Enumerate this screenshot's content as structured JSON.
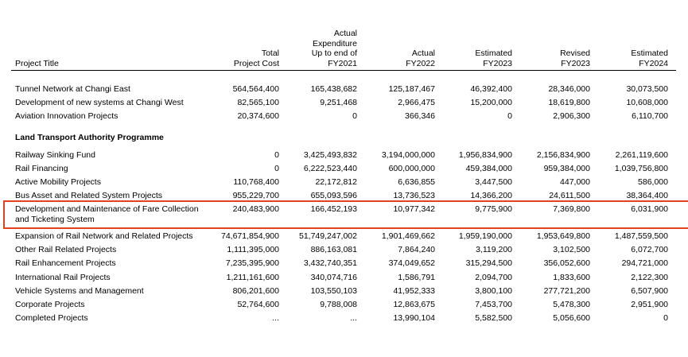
{
  "headers": {
    "project_title": "Project Title",
    "total_cost": "Total\nProject Cost",
    "actual_exp": "Actual\nExpenditure\nUp to end of\nFY2021",
    "actual_fy2022": "Actual\nFY2022",
    "estimated_fy2023": "Estimated\nFY2023",
    "revised_fy2023": "Revised\nFY2023",
    "estimated_fy2024": "Estimated\nFY2024"
  },
  "rows_top": [
    {
      "title": "Tunnel Network at Changi East",
      "v": [
        "564,564,400",
        "165,438,682",
        "125,187,467",
        "46,392,400",
        "28,346,000",
        "30,073,500"
      ]
    },
    {
      "title": "Development of new systems at Changi West",
      "v": [
        "82,565,100",
        "9,251,468",
        "2,966,475",
        "15,200,000",
        "18,619,800",
        "10,608,000"
      ]
    },
    {
      "title": "Aviation Innovation Projects",
      "v": [
        "20,374,600",
        "0",
        "366,346",
        "0",
        "2,906,300",
        "6,110,700"
      ]
    }
  ],
  "section_title": "Land Transport Authority Programme",
  "rows_lta": [
    {
      "title": "Railway Sinking Fund",
      "v": [
        "0",
        "3,425,493,832",
        "3,194,000,000",
        "1,956,834,900",
        "2,156,834,900",
        "2,261,119,600"
      ]
    },
    {
      "title": "Rail Financing",
      "v": [
        "0",
        "6,222,523,440",
        "600,000,000",
        "459,384,000",
        "959,384,000",
        "1,039,756,800"
      ]
    },
    {
      "title": "Active Mobility Projects",
      "v": [
        "110,768,400",
        "22,172,812",
        "6,636,855",
        "3,447,500",
        "447,000",
        "586,000"
      ]
    },
    {
      "title": "Bus Asset and Related System Projects",
      "v": [
        "955,229,700",
        "655,093,596",
        "13,736,523",
        "14,366,200",
        "24,611,500",
        "38,364,400"
      ]
    }
  ],
  "highlight_row": {
    "title": "Development and Maintenance of Fare Collection\nand Ticketing System",
    "v": [
      "240,483,900",
      "166,452,193",
      "10,977,342",
      "9,775,900",
      "7,369,800",
      "6,031,900"
    ]
  },
  "rows_bottom": [
    {
      "title": "Expansion of Rail Network and Related Projects",
      "v": [
        "74,671,854,900",
        "51,749,247,002",
        "1,901,469,662",
        "1,959,190,000",
        "1,953,649,800",
        "1,487,559,500"
      ]
    },
    {
      "title": "Other Rail Related Projects",
      "v": [
        "1,111,395,000",
        "886,163,081",
        "7,864,240",
        "3,119,200",
        "3,102,500",
        "6,072,700"
      ]
    },
    {
      "title": "Rail Enhancement Projects",
      "v": [
        "7,235,395,900",
        "3,432,740,351",
        "374,049,652",
        "315,294,500",
        "356,052,600",
        "294,721,000"
      ]
    },
    {
      "title": "International Rail Projects",
      "v": [
        "1,211,161,600",
        "340,074,716",
        "1,586,791",
        "2,094,700",
        "1,833,600",
        "2,122,300"
      ]
    },
    {
      "title": "Vehicle Systems and Management",
      "v": [
        "806,201,600",
        "103,550,103",
        "41,952,333",
        "3,800,100",
        "277,721,200",
        "6,507,900"
      ]
    },
    {
      "title": "Corporate Projects",
      "v": [
        "52,764,600",
        "9,788,008",
        "12,863,675",
        "7,453,700",
        "5,478,300",
        "2,951,900"
      ]
    },
    {
      "title": "Completed Projects",
      "v": [
        "...",
        "...",
        "13,990,104",
        "5,582,500",
        "5,056,600",
        "0"
      ]
    }
  ],
  "highlight_color": "#e2431e"
}
